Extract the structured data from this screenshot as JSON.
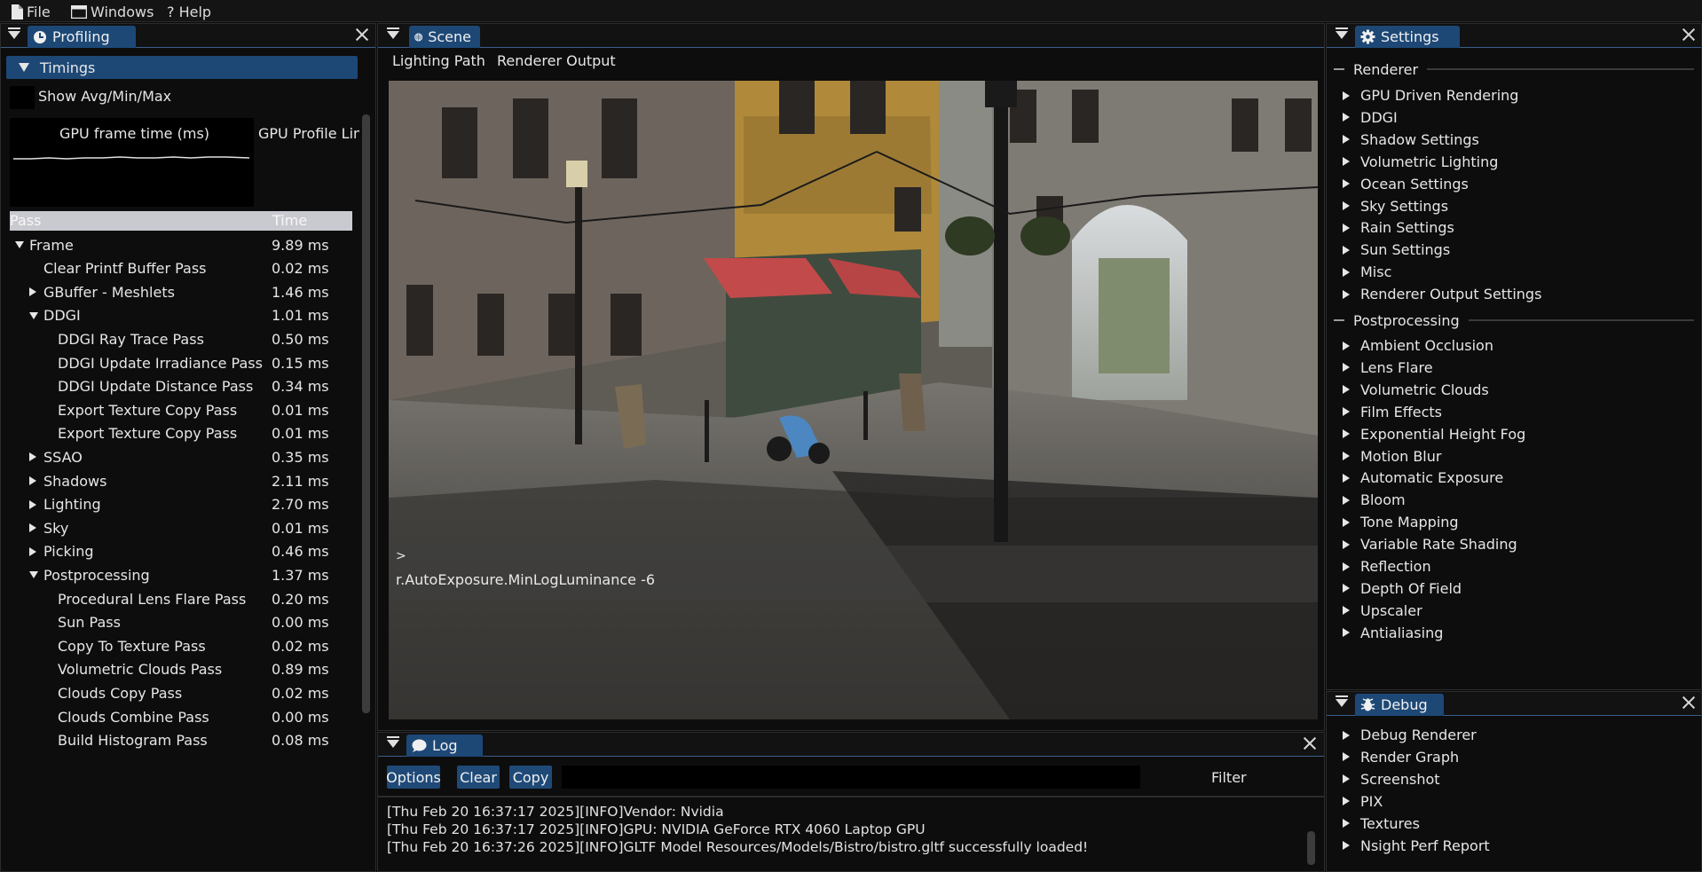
{
  "menu": {
    "file": "File",
    "windows": "Windows",
    "help": "? Help"
  },
  "profiling": {
    "tab": "Profiling",
    "timings_header": "Timings",
    "show_avg_label": "Show Avg/Min/Max",
    "graph_title": "GPU frame time (ms)",
    "graph2_title": "GPU Profile Line",
    "col_pass": "Pass",
    "col_time": "Time",
    "rows": [
      {
        "name": "Frame",
        "time": "9.89 ms",
        "level": 0,
        "arrow": "down"
      },
      {
        "name": "Clear Printf Buffer Pass",
        "time": "0.02 ms",
        "level": 1,
        "arrow": "none"
      },
      {
        "name": "GBuffer - Meshlets",
        "time": "1.46 ms",
        "level": 1,
        "arrow": "right"
      },
      {
        "name": "DDGI",
        "time": "1.01 ms",
        "level": 1,
        "arrow": "down"
      },
      {
        "name": "DDGI Ray Trace Pass",
        "time": "0.50 ms",
        "level": 2,
        "arrow": "none"
      },
      {
        "name": "DDGI Update Irradiance Pass",
        "time": "0.15 ms",
        "level": 2,
        "arrow": "none"
      },
      {
        "name": "DDGI Update Distance Pass",
        "time": "0.34 ms",
        "level": 2,
        "arrow": "none"
      },
      {
        "name": "Export Texture Copy Pass",
        "time": "0.01 ms",
        "level": 2,
        "arrow": "none"
      },
      {
        "name": "Export Texture Copy Pass",
        "time": "0.01 ms",
        "level": 2,
        "arrow": "none"
      },
      {
        "name": "SSAO",
        "time": "0.35 ms",
        "level": 1,
        "arrow": "right"
      },
      {
        "name": "Shadows",
        "time": "2.11 ms",
        "level": 1,
        "arrow": "right"
      },
      {
        "name": "Lighting",
        "time": "2.70 ms",
        "level": 1,
        "arrow": "right"
      },
      {
        "name": "Sky",
        "time": "0.01 ms",
        "level": 1,
        "arrow": "right"
      },
      {
        "name": "Picking",
        "time": "0.46 ms",
        "level": 1,
        "arrow": "right"
      },
      {
        "name": "Postprocessing",
        "time": "1.37 ms",
        "level": 1,
        "arrow": "down"
      },
      {
        "name": "Procedural Lens Flare Pass",
        "time": "0.20 ms",
        "level": 2,
        "arrow": "none"
      },
      {
        "name": "Sun Pass",
        "time": "0.00 ms",
        "level": 2,
        "arrow": "none"
      },
      {
        "name": "Copy To Texture Pass",
        "time": "0.02 ms",
        "level": 2,
        "arrow": "none"
      },
      {
        "name": "Volumetric Clouds Pass",
        "time": "0.89 ms",
        "level": 2,
        "arrow": "none"
      },
      {
        "name": "Clouds Copy Pass",
        "time": "0.02 ms",
        "level": 2,
        "arrow": "none"
      },
      {
        "name": "Clouds Combine Pass",
        "time": "0.00 ms",
        "level": 2,
        "arrow": "none"
      },
      {
        "name": "Build Histogram Pass",
        "time": "0.08 ms",
        "level": 2,
        "arrow": "none"
      }
    ]
  },
  "scene": {
    "tab": "Scene",
    "menu": [
      "Lighting Path",
      "Renderer Output"
    ],
    "console_prompt": ">",
    "console_command": "r.AutoExposure.MinLogLuminance -6"
  },
  "log": {
    "tab": "Log",
    "buttons": {
      "options": "Options",
      "clear": "Clear",
      "copy": "Copy"
    },
    "filter_label": "Filter",
    "filter_value": "",
    "lines": [
      "[Thu Feb 20 16:37:17 2025][INFO]Vendor: Nvidia",
      "[Thu Feb 20 16:37:17 2025][INFO]GPU: NVIDIA GeForce RTX 4060 Laptop GPU",
      "[Thu Feb 20 16:37:26 2025][INFO]GLTF Model Resources/Models/Bistro/bistro.gltf successfully loaded!"
    ]
  },
  "settings": {
    "tab": "Settings",
    "renderer_header": "Renderer",
    "renderer_items": [
      "GPU Driven Rendering",
      "DDGI",
      "Shadow Settings",
      "Volumetric Lighting",
      "Ocean Settings",
      "Sky Settings",
      "Rain Settings",
      "Sun Settings",
      "Misc",
      "Renderer Output Settings"
    ],
    "post_header": "Postprocessing",
    "post_items": [
      "Ambient Occlusion",
      "Lens Flare",
      "Volumetric Clouds",
      "Film Effects",
      "Exponential Height Fog",
      "Motion Blur",
      "Automatic Exposure",
      "Bloom",
      "Tone Mapping",
      "Variable Rate Shading",
      "Reflection",
      "Depth Of Field",
      "Upscaler",
      "Antialiasing"
    ]
  },
  "debug": {
    "tab": "Debug",
    "items": [
      "Debug Renderer",
      "Render Graph",
      "Screenshot",
      "PIX",
      "Textures",
      "Nsight Perf Report"
    ]
  },
  "colors": {
    "accent": "#1d4876",
    "header_bg": "#c9c9d0",
    "panel_bg": "#0d0d0d"
  },
  "icons": {
    "file": "file-icon",
    "windows": "window-icon",
    "profiling": "clock-icon",
    "scene": "globe-icon",
    "settings": "gear-icon",
    "log": "speech-bubble-icon",
    "debug": "bug-icon"
  }
}
